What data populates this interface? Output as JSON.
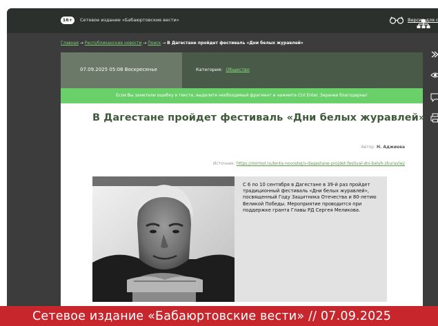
{
  "header": {
    "age_rating": "16+",
    "site_name": "Сетевое издание «Бабаюртовские вести»",
    "visually_impaired_link": "Версия для слабовидящих"
  },
  "breadcrumb": {
    "home": "Главная",
    "section": "Республиканские новости",
    "search": "Поиск",
    "current": "В Дагестане пройдет фестиваль «Дни белых журавлей»"
  },
  "meta": {
    "date": "07.09.2025 05:08 Воскресенье",
    "category_label": "Категория:",
    "category": "Общество"
  },
  "notice": "Если Вы заметили ошибку в тексте, выделите необходимый фрагмент и нажмите Ctrl Enter. Заранее благодарны!",
  "article": {
    "title": "В Дагестане пройдет фестиваль «Дни белых журавлей»",
    "author_label": "Автор:",
    "author": "Н. Аджиева",
    "source_label": "Источник:",
    "source_url": "https://mirmol.ru/lenta-novostej/v-dagestane-projdet-festival-dni-belyh-zhuravlej/",
    "lead": "С 6 по 10 сентября в Дагестане в 39-й раз пройдет традиционный фестиваль «Дни белых журавлей», посвященный Году Защитника Отечества и 80-летию Великой Победы. Мероприятие проводится при поддержке гранта Главы РД Сергея Меликова."
  },
  "banner": "Сетевое издание «Бабаюртовские вести» // 07.09.2025",
  "colors": {
    "topbar": "#2c302c",
    "frame": "#3c3c3c",
    "date_cell": "#6b7a68",
    "meta_bar": "#4a5a48",
    "notice": "#6ad16a",
    "title": "#3f5a3b",
    "link": "#7fd07a",
    "banner": "#c7262d"
  },
  "icons": [
    "glasses-icon",
    "sitemap-icon",
    "share-icon",
    "eye-icon",
    "comment-icon",
    "print-icon"
  ]
}
